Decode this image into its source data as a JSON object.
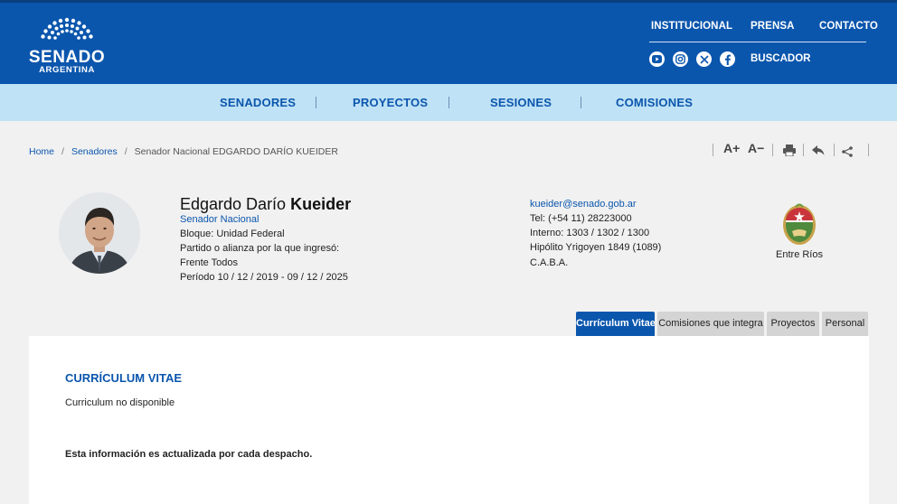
{
  "logo": {
    "word": "SENADO",
    "sub": "ARGENTINA"
  },
  "top_links": [
    "INSTITUCIONAL",
    "PRENSA",
    "CONTACTO"
  ],
  "socials": [
    "youtube-icon",
    "instagram-icon",
    "x-icon",
    "facebook-icon"
  ],
  "buscador": "BUSCADOR",
  "nav": [
    "SENADORES",
    "PROYECTOS",
    "SESIONES",
    "COMISIONES"
  ],
  "breadcrumb": {
    "home": "Home",
    "senadores": "Senadores",
    "current": "Senador Nacional EDGARDO DARÍO KUEIDER"
  },
  "tools": {
    "increase": "A+",
    "decrease": "A−"
  },
  "senator": {
    "first_name": "Edgardo Darío",
    "last_name": "Kueider",
    "role": "Senador Nacional",
    "bloque": "Bloque: Unidad Federal",
    "partido_label": "Partido o alianza por la que ingresó:",
    "partido": "Frente Todos",
    "periodo": "Período 10 / 12 / 2019 - 09 / 12 / 2025"
  },
  "contact": {
    "email": "kueider@senado.gob.ar",
    "tel": "Tel: (+54 11) 28223000",
    "interno": "Interno: 1303 / 1302 / 1300",
    "address": "Hipólito Yrigoyen 1849 (1089)",
    "city": "C.A.B.A."
  },
  "province": "Entre Ríos",
  "tabs": [
    "Currículum Vitae",
    "Comisiones que integra",
    "Proyectos",
    "Personal"
  ],
  "cv": {
    "title": "CURRÍCULUM VITAE",
    "text": "Curriculum no disponible",
    "note": "Esta información es actualizada por cada despacho."
  },
  "colors": {
    "primary": "#0b56ad",
    "nav_band": "#bfe2f6",
    "page_bg": "#f1f1f1",
    "tab_inactive": "#d4d4d4"
  }
}
